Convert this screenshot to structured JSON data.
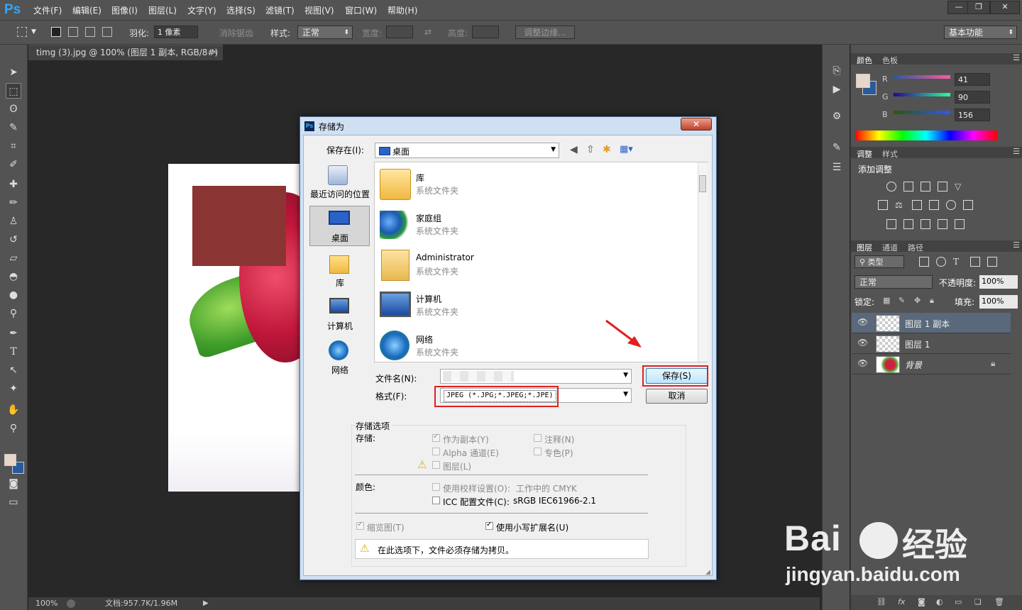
{
  "app": {
    "logo": "Ps",
    "menu": [
      "文件(F)",
      "编辑(E)",
      "图像(I)",
      "图层(L)",
      "文字(Y)",
      "选择(S)",
      "滤镜(T)",
      "视图(V)",
      "窗口(W)",
      "帮助(H)"
    ],
    "window_buttons": [
      "—",
      "❐",
      "✕"
    ]
  },
  "options": {
    "feather_label": "羽化:",
    "feather_value": "1 像素",
    "antialias_label": "消除锯齿",
    "style_label": "样式:",
    "style_value": "正常",
    "width_label": "宽度:",
    "height_label": "高度:",
    "refine_edge": "调整边缘...",
    "workspace": "基本功能"
  },
  "document": {
    "tab_title": "timg (3).jpg @ 100% (图层 1 副本, RGB/8#) *",
    "zoom": "100%",
    "doc_size": "文档:957.7K/1.96M"
  },
  "color_panel": {
    "tabs": [
      "颜色",
      "色板"
    ],
    "r_label": "R",
    "g_label": "G",
    "b_label": "B",
    "r": "41",
    "g": "90",
    "b": "156",
    "fg_color": "#e8d6c8",
    "bg_color": "#295a9c"
  },
  "adjust_panel": {
    "tabs": [
      "调整",
      "样式"
    ],
    "title": "添加调整"
  },
  "layers_panel": {
    "tabs": [
      "图层",
      "通道",
      "路径"
    ],
    "filter_kind": "类型",
    "blend_mode": "正常",
    "opacity_label": "不透明度:",
    "opacity_value": "100%",
    "lock_label": "锁定:",
    "fill_label": "填充:",
    "fill_value": "100%",
    "layers": [
      {
        "name": "图层 1 副本"
      },
      {
        "name": "图层 1"
      },
      {
        "name": "背景"
      }
    ]
  },
  "dialog": {
    "title": "存储为",
    "close": "✕",
    "save_in_label": "保存在(I):",
    "save_in_value": "桌面",
    "places": [
      "最近访问的位置",
      "桌面",
      "库",
      "计算机",
      "网络"
    ],
    "files": [
      {
        "name": "库",
        "type": "系统文件夹"
      },
      {
        "name": "家庭组",
        "type": "系统文件夹"
      },
      {
        "name": "Administrator",
        "type": "系统文件夹"
      },
      {
        "name": "计算机",
        "type": "系统文件夹"
      },
      {
        "name": "网络",
        "type": "系统文件夹"
      }
    ],
    "filename_label": "文件名(N):",
    "format_label": "格式(F):",
    "format_value": "JPEG (*.JPG;*.JPEG;*.JPE)",
    "save_button": "保存(S)",
    "cancel_button": "取消",
    "options_title": "存储选项",
    "store_label": "存储:",
    "as_copy": "作为副本(Y)",
    "notes": "注释(N)",
    "alpha": "Alpha 通道(E)",
    "spot": "专色(P)",
    "layers": "图层(L)",
    "color_label": "颜色:",
    "proof_setup": "使用校样设置(O):",
    "proof_value": "工作中的 CMYK",
    "icc": "ICC 配置文件(C):",
    "icc_value": "sRGB IEC61966-2.1",
    "thumbnail": "缩览图(T)",
    "lowercase_ext": "使用小写扩展名(U)",
    "warning": "在此选项下，文件必须存储为拷贝。"
  },
  "watermark": {
    "brand": "Bai",
    "brand_cn": "经验",
    "url": "jingyan.baidu.com"
  }
}
